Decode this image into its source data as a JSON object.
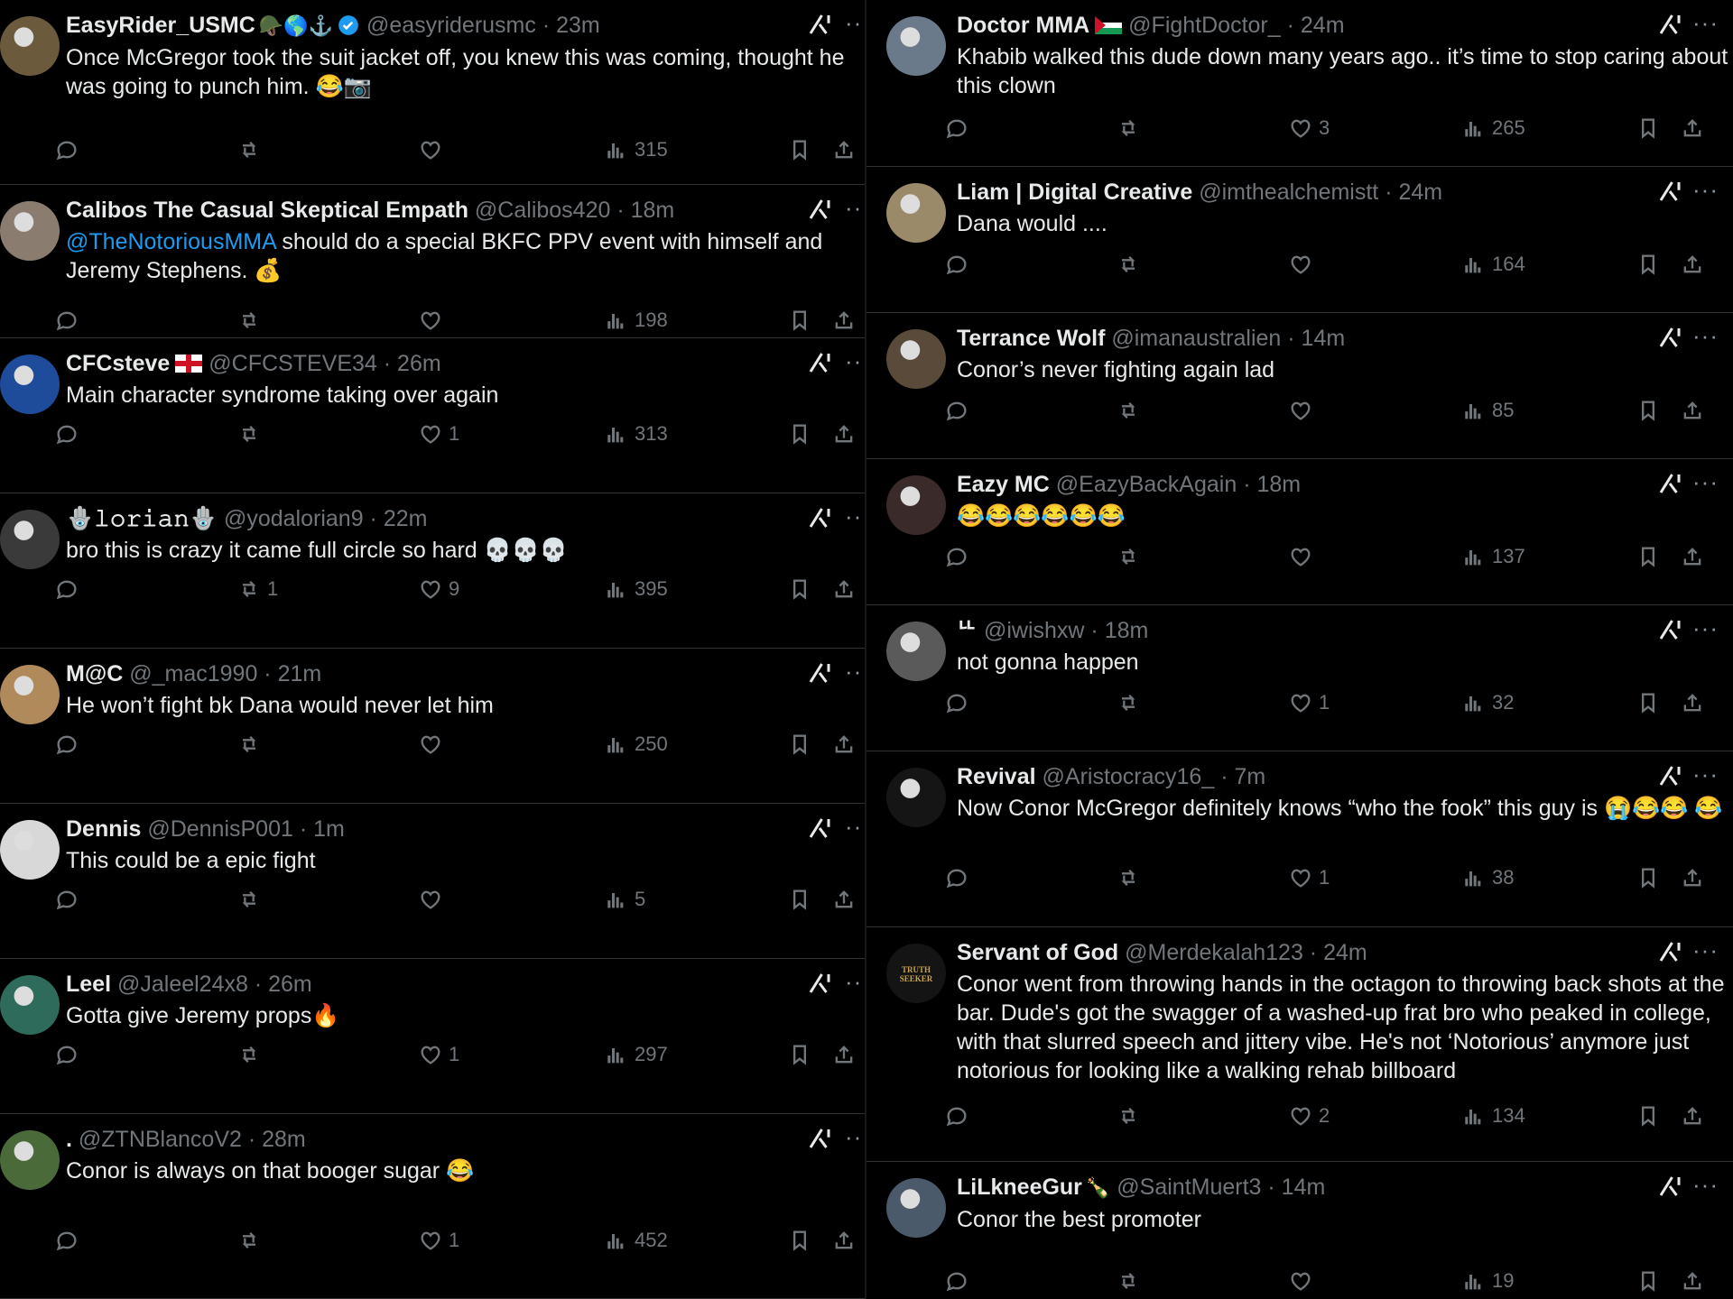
{
  "left": [
    {
      "name": "EasyRider_USMC",
      "badges": "🪖🌎⚓",
      "verified": true,
      "handle": "@easyriderusmc",
      "time": "23m",
      "text": "Once McGregor took the suit jacket off, you knew this was coming, thought he was going to punch him. 😂📷",
      "replies": "",
      "reposts": "",
      "likes": "",
      "views": "315",
      "avatar": "#6b5a3c"
    },
    {
      "name": "Calibos The Casual Skeptical Empath",
      "badges": "",
      "verified": false,
      "handle": "@Calibos420",
      "time": "18m",
      "mention": "@TheNotoriousMMA",
      "text": " should do a special BKFC PPV event with himself and Jeremy Stephens. 💰",
      "replies": "",
      "reposts": "",
      "likes": "",
      "views": "198",
      "avatar": "#8a7d70"
    },
    {
      "name": "CFCsteve",
      "flag": "england",
      "handle": "@CFCSTEVE34",
      "time": "26m",
      "text": "Main character syndrome taking over again",
      "replies": "",
      "reposts": "",
      "likes": "1",
      "views": "313",
      "avatar": "#1e4c9a"
    },
    {
      "name": "🪬𝚕𝚘𝚛𝚒𝚊𝚗🪬",
      "handle": "@yodalorian9",
      "time": "22m",
      "text": "bro this is crazy it came full circle so hard 💀💀💀",
      "replies": "",
      "reposts": "1",
      "likes": "9",
      "views": "395",
      "avatar": "#3a3a3a"
    },
    {
      "name": "M@C",
      "handle": "@_mac1990",
      "time": "21m",
      "text": "He won’t fight bk Dana would never let him",
      "replies": "",
      "reposts": "",
      "likes": "",
      "views": "250",
      "avatar": "#b08a5a"
    },
    {
      "name": "Dennis",
      "handle": "@DennisP001",
      "time": "1m",
      "text": "This could be a epic fight",
      "replies": "",
      "reposts": "",
      "likes": "",
      "views": "5",
      "avatar": "#d8d8d8"
    },
    {
      "name": "Leel",
      "handle": "@Jaleel24x8",
      "time": "26m",
      "text": "Gotta give Jeremy props🔥",
      "replies": "",
      "reposts": "",
      "likes": "1",
      "views": "297",
      "avatar": "#2e6b5a"
    },
    {
      "name": ".",
      "handle": "@ZTNBlancoV2",
      "time": "28m",
      "text": "Conor is always on that booger sugar 😂",
      "replies": "",
      "reposts": "",
      "likes": "1",
      "views": "452",
      "avatar": "#4a6a3a"
    }
  ],
  "right": [
    {
      "name": "Doctor MMA",
      "flag": "palestine",
      "handle": "@FightDoctor_",
      "time": "24m",
      "text": "Khabib walked this dude down many years ago.. it’s time to stop caring about this clown",
      "replies": "",
      "reposts": "",
      "likes": "3",
      "views": "265",
      "avatar": "#6a7a8a"
    },
    {
      "name": "Liam | Digital Creative",
      "handle": "@imthealchemistt",
      "time": "24m",
      "text": "Dana would ....",
      "replies": "",
      "reposts": "",
      "likes": "",
      "views": "164",
      "avatar": "#9a8a6a"
    },
    {
      "name": "Terrance Wolf",
      "handle": "@imanaustralien",
      "time": "14m",
      "text": "Conor’s never fighting again lad",
      "replies": "",
      "reposts": "",
      "likes": "",
      "views": "85",
      "avatar": "#5a4a3a"
    },
    {
      "name": "Eazy MC",
      "handle": "@EazyBackAgain",
      "time": "18m",
      "text": "😂😂😂😂😂😂",
      "replies": "",
      "reposts": "",
      "likes": "",
      "views": "137",
      "avatar": "#3a2a2a"
    },
    {
      "name": "ᄔ",
      "handle": "@iwishxw",
      "time": "18m",
      "text": "not gonna happen",
      "replies": "",
      "reposts": "",
      "likes": "1",
      "views": "32",
      "avatar": "#5a5a5a"
    },
    {
      "name": "Revival",
      "handle": "@Aristocracy16_",
      "time": "7m",
      "text": "Now Conor McGregor definitely knows “who the fook” this guy is 😭😂😂 😂",
      "replies": "",
      "reposts": "",
      "likes": "1",
      "views": "38",
      "avatar": "#151515"
    },
    {
      "name": "Servant of God",
      "handle": "@Merdekalah123",
      "time": "24m",
      "text": "Conor went from throwing hands in the octagon to throwing back shots at the bar. Dude's got the swagger of a washed-up frat bro who peaked in college, with that slurred speech and jittery vibe. He's not ‘Notorious’ anymore just notorious for looking like a walking rehab billboard",
      "avatar_text": "TRUTH SEEKER",
      "replies": "",
      "reposts": "",
      "likes": "2",
      "views": "134",
      "avatar": "#1a1a1a"
    },
    {
      "name": "LiLkneeGur",
      "badges": "🍾",
      "handle": "@SaintMuert3",
      "time": "14m",
      "text": "Conor the best promoter",
      "replies": "",
      "reposts": "",
      "likes": "",
      "views": "19",
      "avatar": "#4a5a6a"
    }
  ]
}
